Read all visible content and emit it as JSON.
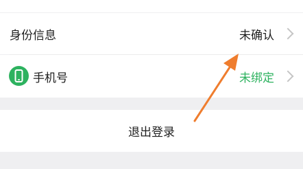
{
  "settings": {
    "identity": {
      "label": "身份信息",
      "value": "未确认"
    },
    "phone": {
      "label": "手机号",
      "value": "未绑定",
      "icon": "phone-icon"
    },
    "logout_label": "退出登录"
  },
  "colors": {
    "accent_green": "#2db25f",
    "annotation_arrow": "#ef7d2e",
    "background": "#efeff1"
  }
}
